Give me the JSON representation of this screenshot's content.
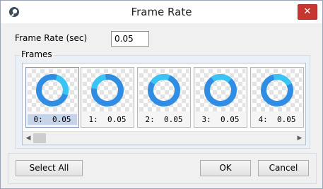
{
  "window": {
    "title": "Frame Rate",
    "close_glyph": "✕",
    "app_icon": "app-logo-icon"
  },
  "form": {
    "frame_rate_label": "Frame Rate (sec)",
    "frame_rate_value": "0.05"
  },
  "frames_group": {
    "label": "Frames",
    "frames": [
      {
        "caption": "0:  0.05",
        "selected": true,
        "arc_start": 0.05,
        "arc_end": 0.3
      },
      {
        "caption": "1:  0.05",
        "selected": false,
        "arc_start": 0.77,
        "arc_end": 0.98
      },
      {
        "caption": "2:  0.05",
        "selected": false,
        "arc_start": 0.84,
        "arc_end": 0.06
      },
      {
        "caption": "3:  0.05",
        "selected": false,
        "arc_start": 0.9,
        "arc_end": 0.12
      },
      {
        "caption": "4:  0.05",
        "selected": false,
        "arc_start": 0.96,
        "arc_end": 0.18
      }
    ],
    "scroll_left_glyph": "◀",
    "scroll_right_glyph": "▶"
  },
  "buttons": {
    "select_all": "Select All",
    "ok": "OK",
    "cancel": "Cancel"
  },
  "colors": {
    "ring_dark": "#2f8de4",
    "ring_light": "#38c4f5",
    "close": "#c7372f"
  }
}
